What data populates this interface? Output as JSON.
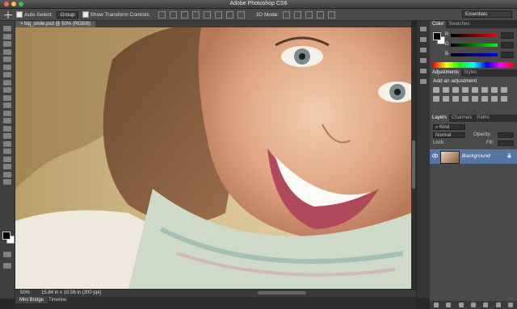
{
  "window": {
    "title": "Adobe Photoshop CS6",
    "traffic_lights": [
      "#fc615d",
      "#fdbc40",
      "#34c84a"
    ]
  },
  "options_bar": {
    "auto_select_label": "Auto-Select:",
    "auto_select_target": "Group",
    "show_transform_label": "Show Transform Controls",
    "mode_3d_label": "3D Mode:",
    "workspace": "Essentials"
  },
  "document": {
    "tab_label": "big_smile.psd @ 50% (RGB/8)",
    "zoom": "50%",
    "doc_info": "15.84 in x 10.56 in (300 ppi)"
  },
  "bottom_tabs": [
    "Mini Bridge",
    "Timeline"
  ],
  "color_panel": {
    "tabs": [
      "Color",
      "Swatches"
    ],
    "active_tab": "Color",
    "sliders": [
      {
        "label": "R",
        "color": "#ff0000"
      },
      {
        "label": "G",
        "color": "#00ff00"
      },
      {
        "label": "B",
        "color": "#0000ff"
      }
    ]
  },
  "adjustments_panel": {
    "tabs": [
      "Adjustments",
      "Styles"
    ],
    "active_tab": "Adjustments",
    "heading": "Add an adjustment"
  },
  "layers_panel": {
    "tabs": [
      "Layers",
      "Channels",
      "Paths"
    ],
    "active_tab": "Layers",
    "filter_kind": "Kind",
    "blend_mode": "Normal",
    "opacity_label": "Opacity:",
    "lock_label": "Lock:",
    "fill_label": "Fill:",
    "layers": [
      {
        "name": "Background",
        "selected": true,
        "locked": true
      }
    ]
  },
  "colors": {
    "accent_selection": "#5776a3",
    "panel_bg": "#4a4a4a"
  }
}
